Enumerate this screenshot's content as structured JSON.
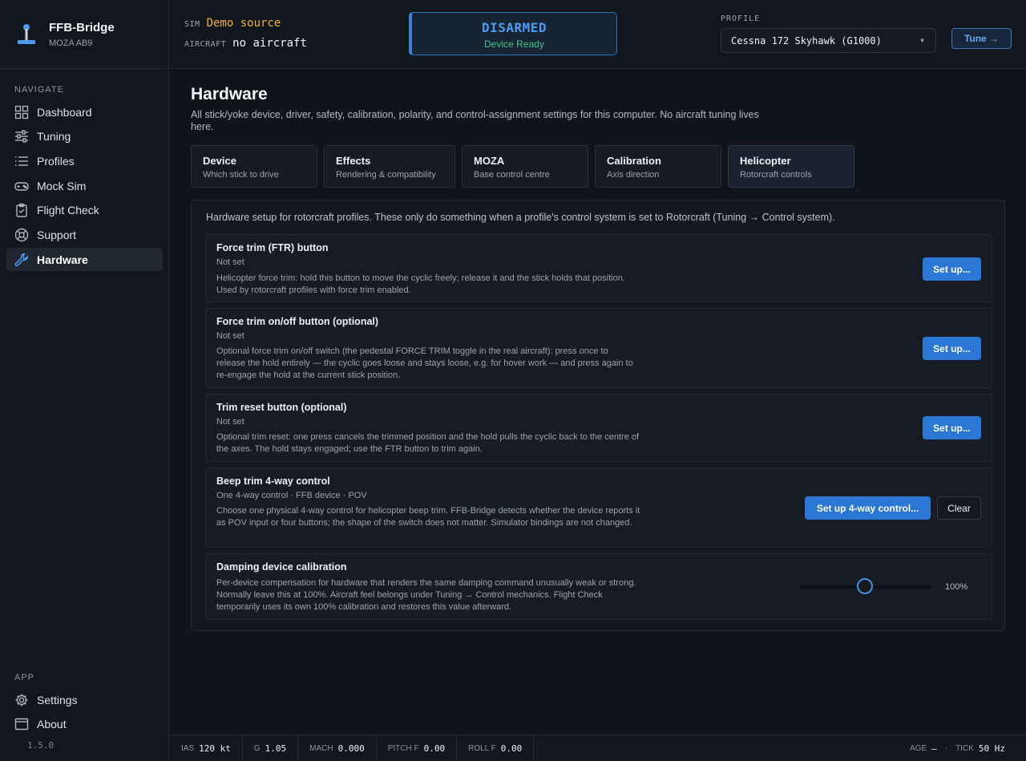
{
  "app": {
    "title": "FFB-Bridge",
    "device": "MOZA AB9",
    "version": "1.5.0"
  },
  "sidebar": {
    "nav_label": "NAVIGATE",
    "items": [
      {
        "label": "Dashboard",
        "icon": "dashboard-icon"
      },
      {
        "label": "Tuning",
        "icon": "sliders-icon"
      },
      {
        "label": "Profiles",
        "icon": "list-icon"
      },
      {
        "label": "Mock Sim",
        "icon": "gamepad-icon"
      },
      {
        "label": "Flight Check",
        "icon": "clipboard-check-icon"
      },
      {
        "label": "Support",
        "icon": "lifebuoy-icon"
      },
      {
        "label": "Hardware",
        "icon": "wrench-icon"
      }
    ],
    "active_item": "Hardware",
    "app_label": "APP",
    "app_items": [
      {
        "label": "Settings",
        "icon": "gear-icon"
      },
      {
        "label": "About",
        "icon": "window-icon"
      }
    ]
  },
  "header": {
    "sim_key": "SIM",
    "sim_value": "Demo source",
    "aircraft_key": "AIRCRAFT",
    "aircraft_value": "no aircraft",
    "arm_state": "DISARMED",
    "arm_sub": "Device Ready",
    "profile_label": "PROFILE",
    "profile_value": "Cessna 172 Skyhawk (G1000)",
    "tune_label": "Tune →"
  },
  "page": {
    "title": "Hardware",
    "description": "All stick/yoke device, driver, safety, calibration, polarity, and control-assignment settings for this computer. No aircraft tuning lives here.",
    "tabs": [
      {
        "title": "Device",
        "sub": "Which stick to drive"
      },
      {
        "title": "Effects",
        "sub": "Rendering & compatibility"
      },
      {
        "title": "MOZA",
        "sub": "Base control centre"
      },
      {
        "title": "Calibration",
        "sub": "Axis direction"
      },
      {
        "title": "Helicopter",
        "sub": "Rotorcraft controls"
      }
    ],
    "active_tab": "Helicopter"
  },
  "panel": {
    "intro": "Hardware setup for rotorcraft profiles. These only do something when a profile's control system is set to Rotorcraft (Tuning → Control system).",
    "cards": [
      {
        "title": "Force trim (FTR) button",
        "status": "Not set",
        "desc": "Helicopter force trim: hold this button to move the cyclic freely; release it and the stick holds that position. Used by rotorcraft profiles with force trim enabled.",
        "button": "Set up..."
      },
      {
        "title": "Force trim on/off button (optional)",
        "status": "Not set",
        "desc": "Optional force trim on/off switch (the pedestal FORCE TRIM toggle in the real aircraft): press once to release the hold entirely — the cyclic goes loose and stays loose, e.g. for hover work — and press again to re-engage the hold at the current stick position.",
        "button": "Set up..."
      },
      {
        "title": "Trim reset button (optional)",
        "status": "Not set",
        "desc": "Optional trim reset: one press cancels the trimmed position and the hold pulls the cyclic back to the centre of the axes. The hold stays engaged; use the FTR button to trim again.",
        "button": "Set up..."
      },
      {
        "title": "Beep trim 4-way control",
        "status": "One 4-way control · FFB device · POV",
        "desc": "Choose one physical 4-way control for helicopter beep trim. FFB-Bridge detects whether the device reports it as POV input or four buttons; the shape of the switch does not matter. Simulator bindings are not changed.",
        "button": "Set up 4-way control...",
        "clear": "Clear"
      },
      {
        "title": "Damping device calibration",
        "desc": "Per-device compensation for hardware that renders the same damping command unusually weak or strong. Normally leave this at 100%. Aircraft feel belongs under Tuning → Control mechanics. Flight Check temporarily uses its own 100% calibration and restores this value afterward.",
        "slider_value": 100,
        "slider_label": "100%"
      }
    ]
  },
  "footer": {
    "telemetry": [
      {
        "k": "IAS",
        "v": "120 kt"
      },
      {
        "k": "G",
        "v": "1.05"
      },
      {
        "k": "MACH",
        "v": "0.000"
      },
      {
        "k": "PITCH F",
        "v": "0.00"
      },
      {
        "k": "ROLL F",
        "v": "0.00"
      }
    ],
    "age_key": "AGE",
    "age_value": "—",
    "sep": "·",
    "tick_key": "TICK",
    "tick_value": "50 Hz"
  },
  "colors": {
    "accent": "#2a77d6",
    "ready": "#46c68a",
    "sim": "#f2b23a",
    "disarmed": "#4b9bf5"
  }
}
